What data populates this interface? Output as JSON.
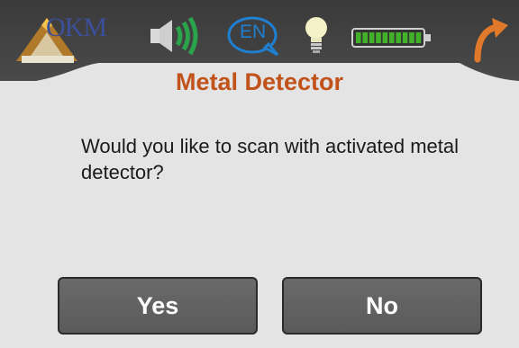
{
  "header": {
    "logo_text": "OKM",
    "language_label": "EN",
    "battery_level": 1.0,
    "icons": [
      "okm-logo",
      "speaker-icon",
      "language-icon",
      "lightbulb-icon",
      "battery-icon",
      "back-arrow-icon"
    ]
  },
  "dialog": {
    "title": "Metal Detector",
    "message": "Would you like to scan with activated metal detector?",
    "yes_label": "Yes",
    "no_label": "No"
  },
  "colors": {
    "title": "#c0521a",
    "button_bg": "#606060",
    "background": "#e4e4e4",
    "battery": "#43b02a",
    "accent_back": "#e07a2a"
  }
}
